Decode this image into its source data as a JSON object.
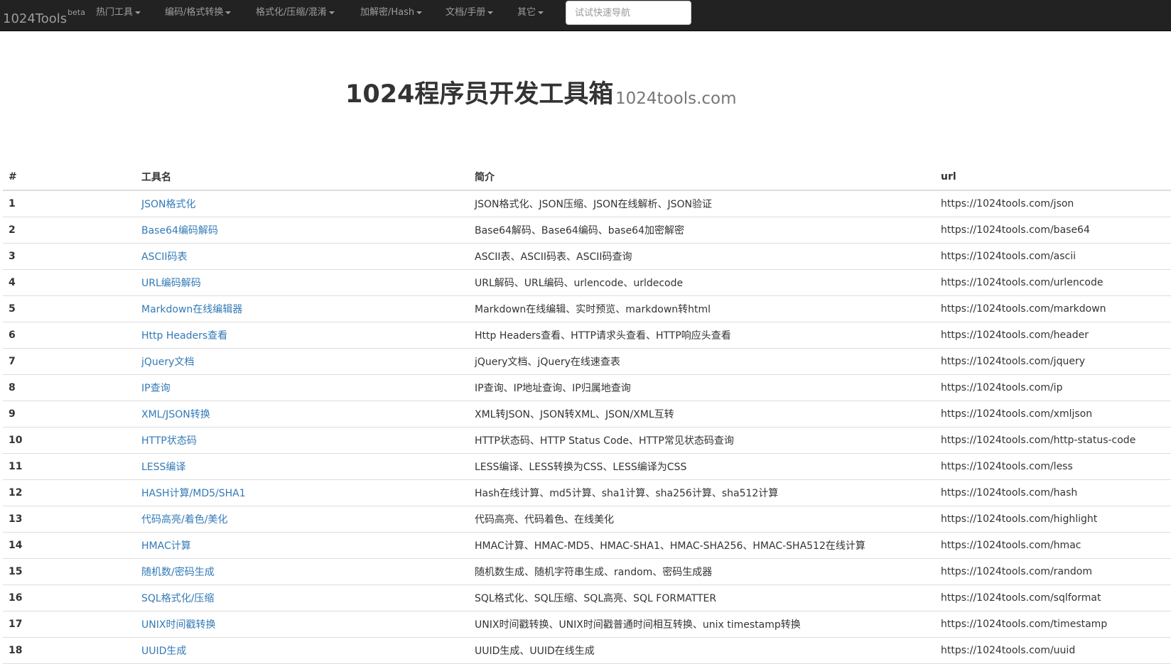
{
  "navbar": {
    "brand": "1024Tools",
    "brand_badge": "beta",
    "menus": [
      {
        "label": "热门工具"
      },
      {
        "label": "编码/格式转换"
      },
      {
        "label": "格式化/压缩/混淆"
      },
      {
        "label": "加解密/Hash"
      },
      {
        "label": "文档/手册"
      },
      {
        "label": "其它"
      }
    ],
    "search_placeholder": "试试快速导航"
  },
  "hero": {
    "title": "1024程序员开发工具箱",
    "subtitle": "1024tools.com"
  },
  "table": {
    "headers": [
      "#",
      "工具名",
      "简介",
      "url"
    ],
    "rows": [
      {
        "num": "1",
        "name": "JSON格式化",
        "desc": "JSON格式化、JSON压缩、JSON在线解析、JSON验证",
        "url": "https://1024tools.com/json"
      },
      {
        "num": "2",
        "name": "Base64编码解码",
        "desc": "Base64解码、Base64编码、base64加密解密",
        "url": "https://1024tools.com/base64"
      },
      {
        "num": "3",
        "name": "ASCII码表",
        "desc": "ASCII表、ASCII码表、ASCII码查询",
        "url": "https://1024tools.com/ascii"
      },
      {
        "num": "4",
        "name": "URL编码解码",
        "desc": "URL解码、URL编码、urlencode、urldecode",
        "url": "https://1024tools.com/urlencode"
      },
      {
        "num": "5",
        "name": "Markdown在线编辑器",
        "desc": "Markdown在线编辑、实时预览、markdown转html",
        "url": "https://1024tools.com/markdown"
      },
      {
        "num": "6",
        "name": "Http Headers查看",
        "desc": "Http Headers查看、HTTP请求头查看、HTTP响应头查看",
        "url": "https://1024tools.com/header"
      },
      {
        "num": "7",
        "name": "jQuery文档",
        "desc": "jQuery文档、jQuery在线速查表",
        "url": "https://1024tools.com/jquery"
      },
      {
        "num": "8",
        "name": "IP查询",
        "desc": "IP查询、IP地址查询、IP归属地查询",
        "url": "https://1024tools.com/ip"
      },
      {
        "num": "9",
        "name": "XML/JSON转换",
        "desc": "XML转JSON、JSON转XML、JSON/XML互转",
        "url": "https://1024tools.com/xmljson"
      },
      {
        "num": "10",
        "name": "HTTP状态码",
        "desc": "HTTP状态码、HTTP Status Code、HTTP常见状态码查询",
        "url": "https://1024tools.com/http-status-code"
      },
      {
        "num": "11",
        "name": "LESS编译",
        "desc": "LESS编译、LESS转换为CSS、LESS编译为CSS",
        "url": "https://1024tools.com/less"
      },
      {
        "num": "12",
        "name": "HASH计算/MD5/SHA1",
        "desc": "Hash在线计算、md5计算、sha1计算、sha256计算、sha512计算",
        "url": "https://1024tools.com/hash"
      },
      {
        "num": "13",
        "name": "代码高亮/着色/美化",
        "desc": "代码高亮、代码着色、在线美化",
        "url": "https://1024tools.com/highlight"
      },
      {
        "num": "14",
        "name": "HMAC计算",
        "desc": "HMAC计算、HMAC-MD5、HMAC-SHA1、HMAC-SHA256、HMAC-SHA512在线计算",
        "url": "https://1024tools.com/hmac"
      },
      {
        "num": "15",
        "name": "随机数/密码生成",
        "desc": "随机数生成、随机字符串生成、random、密码生成器",
        "url": "https://1024tools.com/random"
      },
      {
        "num": "16",
        "name": "SQL格式化/压缩",
        "desc": "SQL格式化、SQL压缩、SQL高亮、SQL FORMATTER",
        "url": "https://1024tools.com/sqlformat"
      },
      {
        "num": "17",
        "name": "UNIX时间戳转换",
        "desc": "UNIX时间戳转换、UNIX时间戳普通时间相互转换、unix timestamp转换",
        "url": "https://1024tools.com/timestamp"
      },
      {
        "num": "18",
        "name": "UUID生成",
        "desc": "UUID生成、UUID在线生成",
        "url": "https://1024tools.com/uuid"
      }
    ]
  },
  "colors": {
    "navbar_bg": "#222222",
    "nav_text": "#9d9d9d",
    "link": "#337ab7",
    "text": "#333333",
    "subtle": "#777777",
    "border": "#dddddd"
  }
}
